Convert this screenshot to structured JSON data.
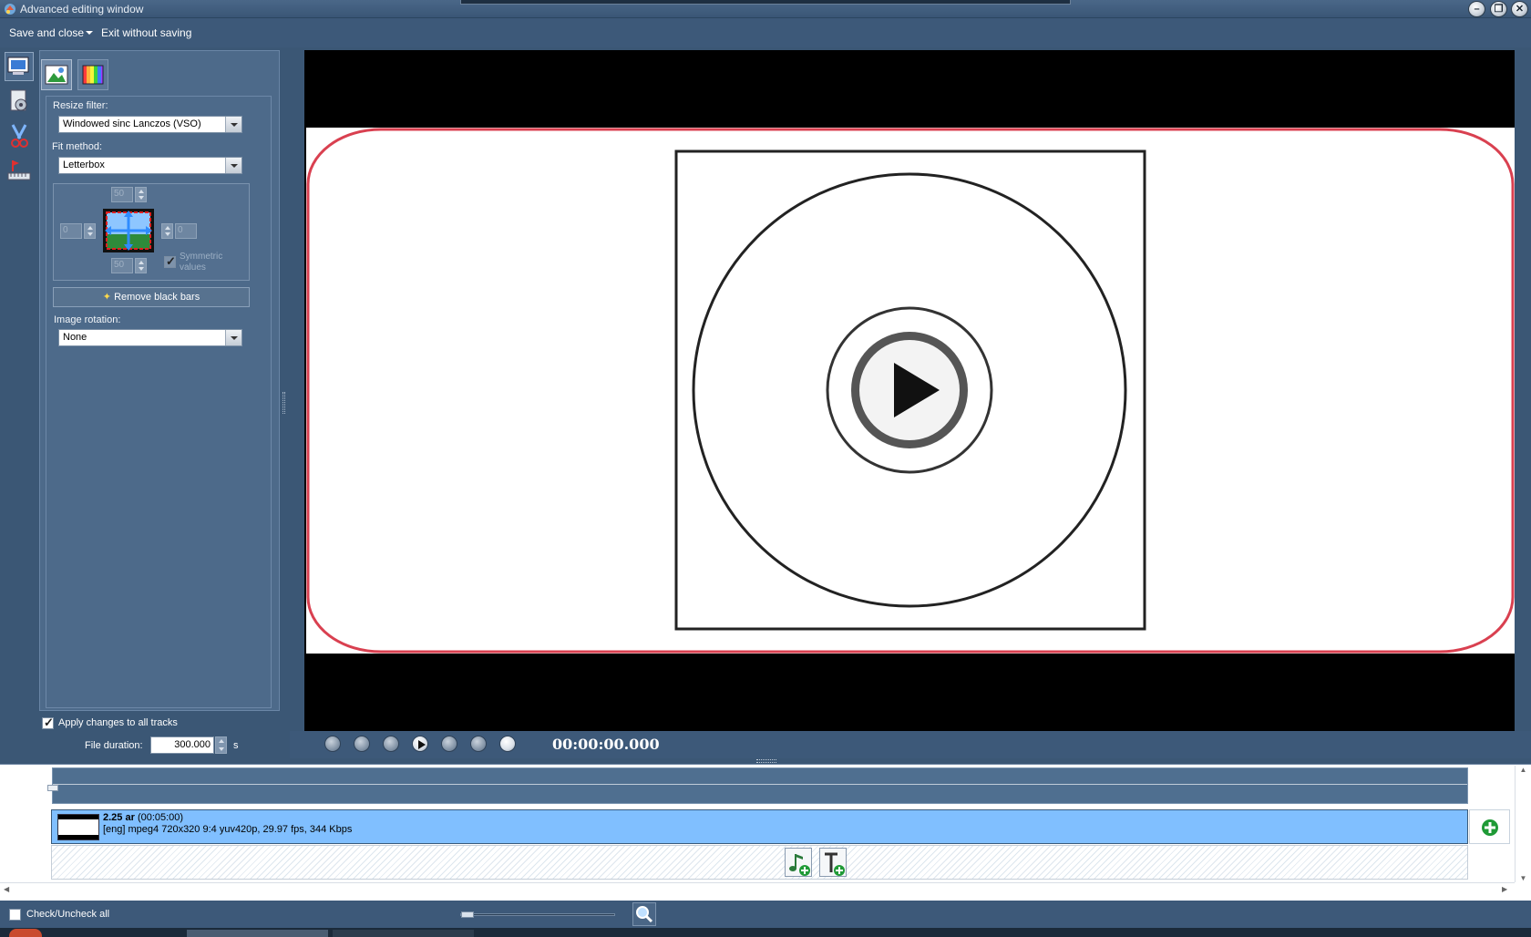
{
  "window": {
    "title": "Advanced editing window",
    "buttons": [
      "minimize-icon",
      "restore-icon",
      "close-icon"
    ]
  },
  "menu": {
    "save_close": "Save and close",
    "exit_without_saving": "Exit without saving"
  },
  "rail": {
    "items": [
      "video-settings-icon",
      "audio-disc-icon",
      "cut-icon",
      "chapters-icon"
    ]
  },
  "tabs": [
    "picture-icon",
    "color-bars-icon"
  ],
  "settings": {
    "resize_filter_label": "Resize filter:",
    "resize_filter_value": "Windowed sinc Lanczos (VSO)",
    "fit_method_label": "Fit method:",
    "fit_method_value": "Letterbox",
    "crop_top": "50",
    "crop_bottom": "50",
    "crop_left": "0",
    "crop_right": "0",
    "symmetric_line1": "Symmetric",
    "symmetric_line2": "values",
    "remove_black_bars": "Remove black bars",
    "image_rotation_label": "Image rotation:",
    "image_rotation_value": "None",
    "apply_all_tracks": "Apply changes to all tracks",
    "file_duration_label": "File duration:",
    "file_duration_value": "300.000",
    "file_duration_unit": "s"
  },
  "player": {
    "timecode": "00:00:00.000"
  },
  "track": {
    "title": "2.25 ar",
    "duration": "(00:05:00)",
    "details": "[eng] mpeg4 720x320 9:4 yuv420p, 29.97 fps, 344 Kbps"
  },
  "status": {
    "check_all": "Check/Uncheck all"
  },
  "colors": {
    "panel": "#4d6a8a",
    "track": "#80bfff",
    "frame_border": "#d94050"
  }
}
